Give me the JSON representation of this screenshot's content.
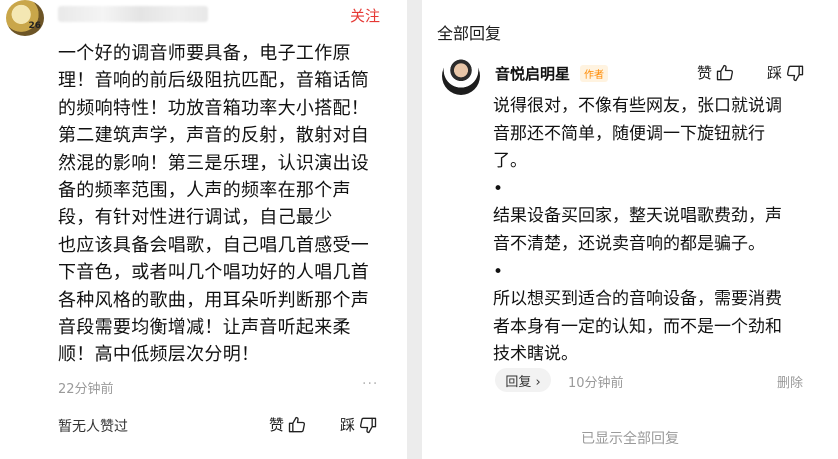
{
  "comment": {
    "follow_label": "关注",
    "lines": [
      "一个好的调音师要具备，电子工作原",
      "理！音响的前后级阻抗匹配，音箱话筒",
      "的频响特性！功放音箱功率大小搭配！",
      "第二建筑声学，声音的反射，散射对自",
      "然混的影响！第三是乐理，认识演出设",
      "备的频率范围，人声的频率在那个声",
      "段，有针对性进行调试，自己最少",
      "也应该具备会唱歌，自己唱几首感受一",
      "下音色，或者叫几个唱功好的人唱几首",
      "各种风格的歌曲，用耳朵听判断那个声",
      "音段需要均衡增减！让声音听起来柔",
      "顺！高中低频层次分明！"
    ],
    "time": "22分钟前",
    "more": "···",
    "no_likes": "暂无人赞过",
    "like_label": "赞",
    "dislike_label": "踩"
  },
  "replies": {
    "header": "全部回复",
    "author": "音悦启明星",
    "author_tag": "作者",
    "like_label": "赞",
    "dislike_label": "踩",
    "lines": [
      "说得很对，不像有些网友，张口就说调",
      "音那还不简单，随便调一下旋钮就行",
      "了。",
      "•",
      "结果设备买回家，整天说唱歌费劲，声",
      "音不清楚，还说卖音响的都是骗子。",
      "•",
      "所以想买到适合的音响设备，需要消费",
      "者本身有一定的认知，而不是一个劲和",
      "技术瞎说。"
    ],
    "reply_label": "回复 ›",
    "time": "10分钟前",
    "delete_label": "删除",
    "footer": "已显示全部回复"
  }
}
